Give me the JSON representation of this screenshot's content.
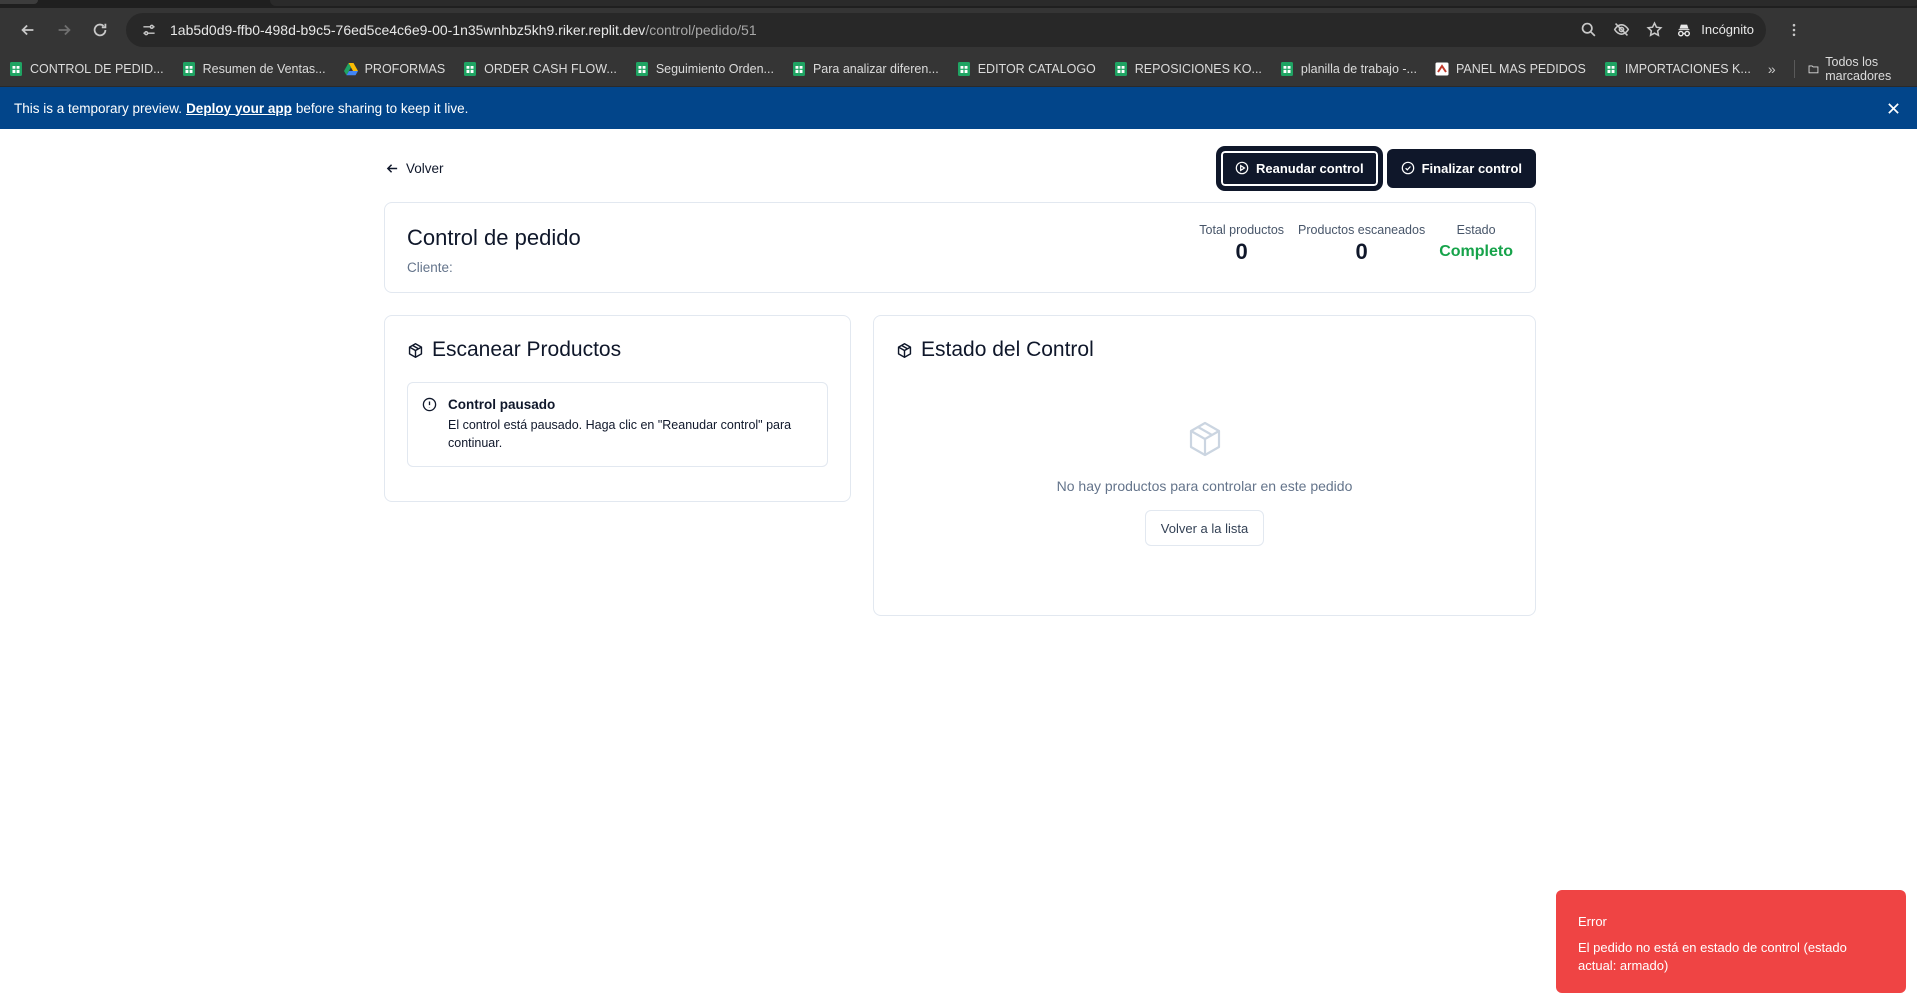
{
  "browser": {
    "url_host": "1ab5d0d9-ffb0-498d-b9c5-76ed5ce4c6e9-00-1n35wnhbz5kh9.riker.replit.dev",
    "url_path": "/control/pedido/51",
    "incognito_label": "Incógnito",
    "bookmarks": [
      {
        "label": "CONTROL DE PEDID...",
        "icon": "sheets-icon"
      },
      {
        "label": "Resumen de Ventas...",
        "icon": "sheets-icon"
      },
      {
        "label": "PROFORMAS",
        "icon": "drive-icon"
      },
      {
        "label": "ORDER CASH FLOW...",
        "icon": "sheets-icon"
      },
      {
        "label": "Seguimiento Orden...",
        "icon": "sheets-icon"
      },
      {
        "label": "Para analizar diferen...",
        "icon": "sheets-icon"
      },
      {
        "label": "EDITOR CATALOGO",
        "icon": "sheets-icon"
      },
      {
        "label": "REPOSICIONES KO...",
        "icon": "sheets-icon"
      },
      {
        "label": "planilla de trabajo -...",
        "icon": "sheets-icon"
      },
      {
        "label": "PANEL MAS PEDIDOS",
        "icon": "app-icon"
      },
      {
        "label": "IMPORTACIONES K...",
        "icon": "sheets-icon"
      }
    ],
    "more_chevron": "»",
    "all_bookmarks_label": "Todos los marcadores"
  },
  "banner": {
    "prefix": "This is a temporary preview.",
    "link": "Deploy your app",
    "suffix": "before sharing to keep it live."
  },
  "page": {
    "back_label": "Volver",
    "resume_label": "Reanudar control",
    "finish_label": "Finalizar control",
    "title": "Control de pedido",
    "client_label": "Cliente:",
    "stats": {
      "total_label": "Total productos",
      "total_value": "0",
      "scanned_label": "Productos escaneados",
      "scanned_value": "0",
      "status_label": "Estado",
      "status_value": "Completo"
    },
    "scan_card": {
      "title": "Escanear Productos",
      "alert_title": "Control pausado",
      "alert_text": "El control está pausado. Haga clic en \"Reanudar control\" para continuar."
    },
    "status_card": {
      "title": "Estado del Control",
      "empty_text": "No hay productos para controlar en este pedido",
      "back_list_label": "Volver a la lista"
    }
  },
  "toast": {
    "title": "Error",
    "message": "El pedido no está en estado de control (estado actual: armado)"
  },
  "colors": {
    "primary": "#0f172a",
    "success": "#16a34a",
    "error": "#ef4444",
    "banner": "#02458a"
  }
}
